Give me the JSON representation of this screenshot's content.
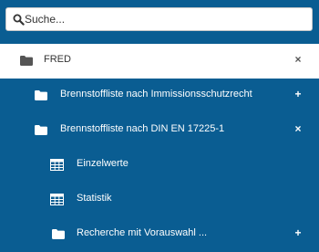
{
  "search": {
    "placeholder": "Suche..."
  },
  "tree": {
    "root": {
      "label": "FRED",
      "icon": "folder-icon",
      "toggle": "×"
    },
    "items": [
      {
        "label": "Brennstoffliste nach Immissionsschutzrecht",
        "icon": "folder-icon",
        "toggle": "+"
      },
      {
        "label": "Brennstoffliste nach DIN EN 17225-1",
        "icon": "folder-icon",
        "toggle": "×"
      },
      {
        "label": "Einzelwerte",
        "icon": "table-icon"
      },
      {
        "label": "Statistik",
        "icon": "table-icon"
      },
      {
        "label": "Recherche mit Vorauswahl ...",
        "icon": "folder-icon",
        "toggle": "+"
      }
    ]
  },
  "colors": {
    "background": "#0a5d92",
    "root_row": "#ffffff"
  }
}
